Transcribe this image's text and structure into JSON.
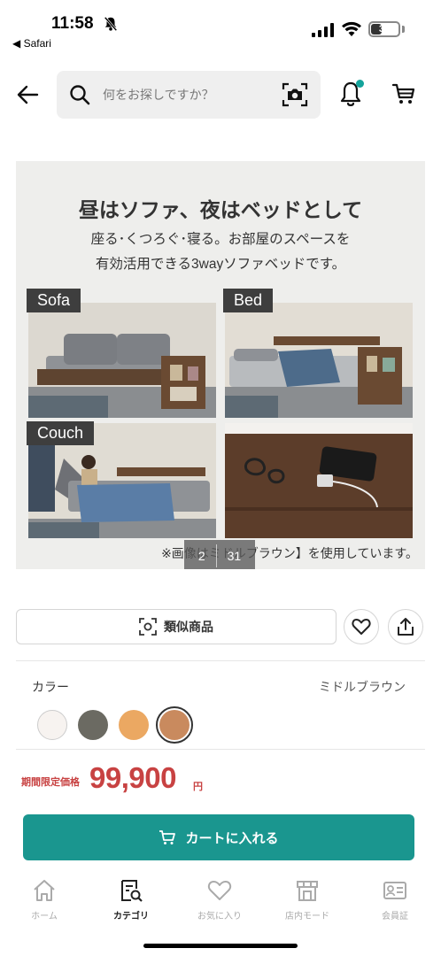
{
  "status_bar": {
    "time": "11:58",
    "back_app": "◀ Safari",
    "battery": "38",
    "battery_level": 0.38
  },
  "search": {
    "placeholder": "何をお探しですか？"
  },
  "icons": {
    "back": "back-arrow-icon",
    "search": "search-icon",
    "camera": "camera-search-icon",
    "notification": "bell-icon",
    "cart": "cart-icon"
  },
  "product_image": {
    "headline": "昼はソファ、夜はベッドとして",
    "sub_line1": "座る･くつろぐ･寝る。お部屋のスペースを",
    "sub_line2": "有効活用できる3wayソファベッドです。",
    "panels": [
      "Sofa",
      "Bed",
      "Couch"
    ],
    "note": "※画像はミドルブラウン】を使用しています。",
    "counter_current": "2",
    "counter_total": "31"
  },
  "actions": {
    "similar_label": "類似商品"
  },
  "color": {
    "label": "カラー",
    "selected_name": "ミドルブラウン",
    "swatches": [
      "#f7f3f0",
      "#6b6a62",
      "#eba862",
      "#c98a5e"
    ],
    "selected_index": 3
  },
  "price": {
    "label": "期間限定価格",
    "value": "99,900",
    "unit": "円",
    "color": "#c84242"
  },
  "cart_button": {
    "label": "カートに入れる",
    "color": "#1a968f"
  },
  "bottom_nav": {
    "tabs": [
      {
        "label": "ホーム",
        "icon": "home-icon"
      },
      {
        "label": "カテゴリ",
        "icon": "category-search-icon"
      },
      {
        "label": "お気に入り",
        "icon": "heart-icon"
      },
      {
        "label": "店内モード",
        "icon": "store-icon"
      },
      {
        "label": "会員証",
        "icon": "member-card-icon"
      }
    ],
    "active_index": 1
  }
}
